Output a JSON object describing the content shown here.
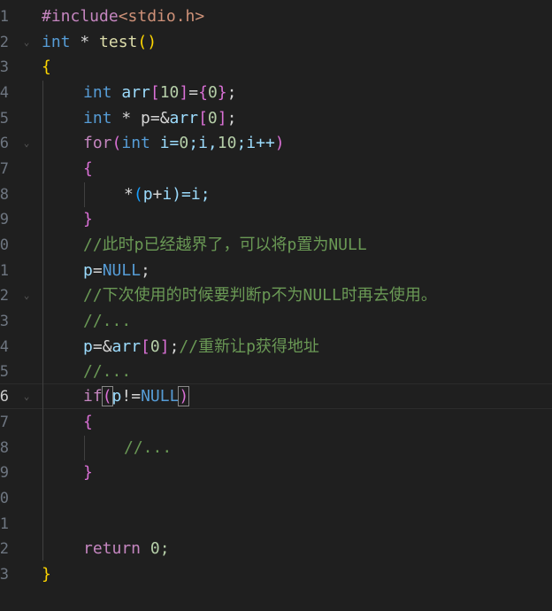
{
  "editor": {
    "language": "C",
    "line_numbers": [
      "1",
      "2",
      "3",
      "4",
      "5",
      "6",
      "7",
      "8",
      "9",
      "0",
      "1",
      "2",
      "3",
      "4",
      "5",
      "6",
      "7",
      "8",
      "9",
      "0",
      "1",
      "2",
      "3"
    ],
    "active_line_index": 15,
    "tokens": {
      "include": "#include",
      "header": "<stdio.h>",
      "int": "int",
      "star": " * ",
      "test": "test",
      "paren_open": "(",
      "paren_close": ")",
      "brace_open": "{",
      "brace_close": "}",
      "arr": "arr",
      "bracket_open": "[",
      "bracket_close": "]",
      "ten": "10",
      "zero": "0",
      "eq": "=",
      "semi": ";",
      "p": "p",
      "amp": "&",
      "for": "for",
      "i": "i",
      "i_decl": " i=",
      "for_rest_a": ";i,",
      "for_rest_b": ";i++",
      "deref": "*",
      "plus": "+",
      "eq_i_semi": ")=i;",
      "comment_boundary": "//此时p已经越界了，可以将p置为NULL",
      "null": "NULL",
      "comment_check": "//下次使用的时候要判断p不为NULL时再去使用。",
      "comment_ellipsis": "//...",
      "comment_reget": "//重新让p获得地址",
      "if": "if",
      "neq": "!=",
      "return": "return",
      "ret_val": " 0;",
      "eq_ptr": " * p=&"
    }
  }
}
